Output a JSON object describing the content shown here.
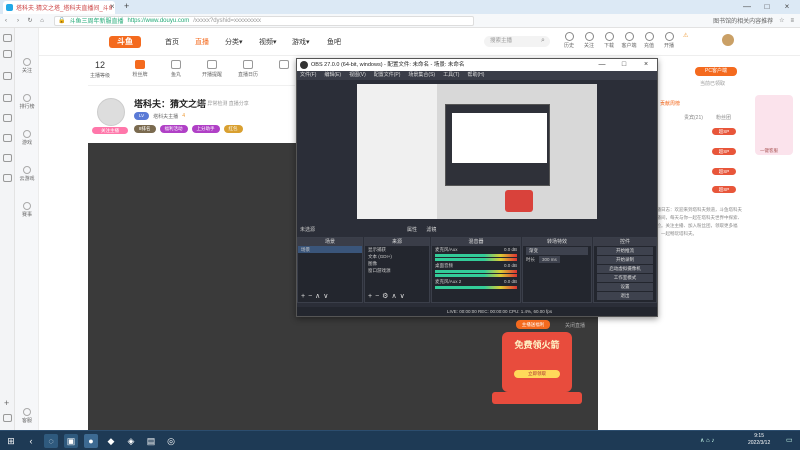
{
  "browser": {
    "tab_title": "塔科夫·猜文之塔_塔科夫直播间_斗鱼直播",
    "tab_close": "×",
    "new_tab": "+",
    "address_prefix": "斗鱼三周年新服直播",
    "address_host": "https://www.douyu.com",
    "address_rest": "/xxxxx?dyshid=xxxxxxxxx",
    "address_right": "图书馆的相关内容推荐",
    "win_controls": [
      "—",
      "□",
      "×"
    ]
  },
  "nav": {
    "logo": "斗鱼",
    "links": [
      "首页",
      "直播",
      "分类▾",
      "视频▾",
      "游戏▾",
      "鱼吧"
    ],
    "active_index": 1,
    "search_placeholder": "搜索主播",
    "header_icons": [
      "历史",
      "关注",
      "下载",
      "客户端",
      "充值",
      "开播"
    ],
    "header_warning": "⚠"
  },
  "stats": {
    "level": "12",
    "level_label": "主播等级",
    "items": [
      "粉丝牌",
      "鱼丸",
      "开播提醒",
      "直播日历"
    ],
    "badge": "主播"
  },
  "room": {
    "title": "塔科夫：猜文之塔",
    "subtitle": "举报   异常检测   直播分享",
    "line2_prefix": "LV",
    "line2_text": "塔科夫主播",
    "line2_count": "4",
    "tags": [
      "8排名",
      "福利活动",
      "上分助手",
      "红包"
    ],
    "badge": "关注主播"
  },
  "right_panel": {
    "pc_ranking": "PC客户端",
    "pc_sub": "当前已领取",
    "ranking_tabs": [
      "贡献周榜",
      "贵宾(21)",
      "粉丝团"
    ],
    "badges": [
      "超SP",
      "超SP",
      "超SP",
      "超SP"
    ],
    "anime_caption": "一键客服",
    "desc": "直播日志：欢迎来到塔科夫频道，斗鱼塔科夫直播间，每天与你一起在塔科夫世界中探索、冒险。关注主播、加入粉丝团，领取更多福利，一起畅玩塔科夫。"
  },
  "obs": {
    "title": "OBS 27.0.0 (64-bit, windows) - 配置文件: 未命名 - 场景: 未命名",
    "menu": [
      "文件(F)",
      "编辑(E)",
      "视图(V)",
      "配置文件(P)",
      "场景集合(S)",
      "工具(T)",
      "帮助(H)"
    ],
    "scene_label": "未选源",
    "properties_label": "属性",
    "filters_label": "滤镜",
    "docks": {
      "scenes": {
        "header": "场景",
        "rows": [
          "场景"
        ]
      },
      "sources": {
        "header": "来源",
        "rows": [
          "显示捕获",
          "文本 (GDI+)",
          "图像",
          "窗口游戏源"
        ]
      },
      "mixer": {
        "header": "混音器",
        "rows": [
          "麦克风/Aux",
          "桌面音频",
          "麦克风/Aux 2"
        ],
        "levels": [
          "0.0 dB",
          "0.0 dB",
          "0.0 dB"
        ]
      },
      "transitions": {
        "header": "转场特效",
        "fade": "渐变",
        "duration_label": "时长",
        "duration": "300 ms"
      },
      "controls": {
        "header": "控件",
        "buttons": [
          "开始推流",
          "开始录制",
          "启动虚拟摄像机",
          "工作室模式",
          "设置",
          "退出"
        ]
      }
    },
    "status": "LIVE: 00:00:00    REC: 00:00:00    CPU: 1.4%, 60.00 fps"
  },
  "promo": {
    "top": "主播送福利",
    "main": "免费领火箭",
    "button": "立即领取"
  },
  "close_room": "关闭直播",
  "taskbar": {
    "time": "9:15",
    "date": "2022/3/12"
  }
}
